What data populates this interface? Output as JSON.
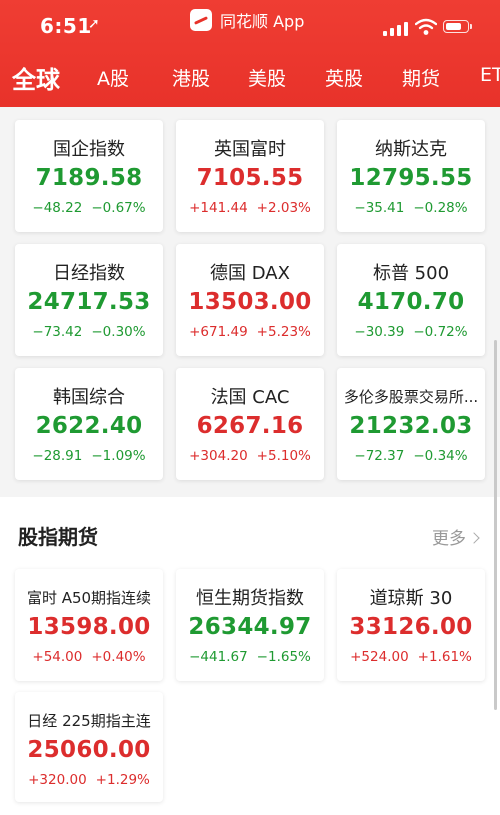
{
  "status_bar": {
    "time": "6:51",
    "location_icon": "location-arrow-icon",
    "app_name": "同花顺 App",
    "battery_level": 0.8
  },
  "tabs": [
    {
      "label": "全球",
      "active": true
    },
    {
      "label": "A股"
    },
    {
      "label": "港股"
    },
    {
      "label": "美股"
    },
    {
      "label": "英股"
    },
    {
      "label": "期货"
    },
    {
      "label": "ET"
    }
  ],
  "indices": [
    {
      "name": "国企指数",
      "price": "7189.58",
      "change": "−48.22",
      "pct": "−0.67%",
      "dir": "down"
    },
    {
      "name": "英国富时",
      "price": "7105.55",
      "change": "+141.44",
      "pct": "+2.03%",
      "dir": "up"
    },
    {
      "name": "纳斯达克",
      "price": "12795.55",
      "change": "−35.41",
      "pct": "−0.28%",
      "dir": "down"
    },
    {
      "name": "日经指数",
      "price": "24717.53",
      "change": "−73.42",
      "pct": "−0.30%",
      "dir": "down"
    },
    {
      "name": "德国 DAX",
      "price": "13503.00",
      "change": "+671.49",
      "pct": "+5.23%",
      "dir": "up"
    },
    {
      "name": "标普 500",
      "price": "4170.70",
      "change": "−30.39",
      "pct": "−0.72%",
      "dir": "down"
    },
    {
      "name": "韩国综合",
      "price": "2622.40",
      "change": "−28.91",
      "pct": "−1.09%",
      "dir": "down"
    },
    {
      "name": "法国 CAC",
      "price": "6267.16",
      "change": "+304.20",
      "pct": "+5.10%",
      "dir": "up"
    },
    {
      "name": "多伦多股票交易所...",
      "price": "21232.03",
      "change": "−72.37",
      "pct": "−0.34%",
      "dir": "down"
    }
  ],
  "futures_section": {
    "title": "股指期货",
    "more": "更多"
  },
  "futures": [
    {
      "name": "富时 A50期指连续",
      "price": "13598.00",
      "change": "+54.00",
      "pct": "+0.40%",
      "dir": "up"
    },
    {
      "name": "恒生期货指数",
      "price": "26344.97",
      "change": "−441.67",
      "pct": "−1.65%",
      "dir": "down"
    },
    {
      "name": "道琼斯 30",
      "price": "33126.00",
      "change": "+524.00",
      "pct": "+1.61%",
      "dir": "up"
    },
    {
      "name": "日经 225期指主连",
      "price": "25060.00",
      "change": "+320.00",
      "pct": "+1.29%",
      "dir": "up"
    }
  ],
  "colors": {
    "brand_red": "#e8322a",
    "up": "#dc2d2d",
    "down": "#1f9a32"
  }
}
